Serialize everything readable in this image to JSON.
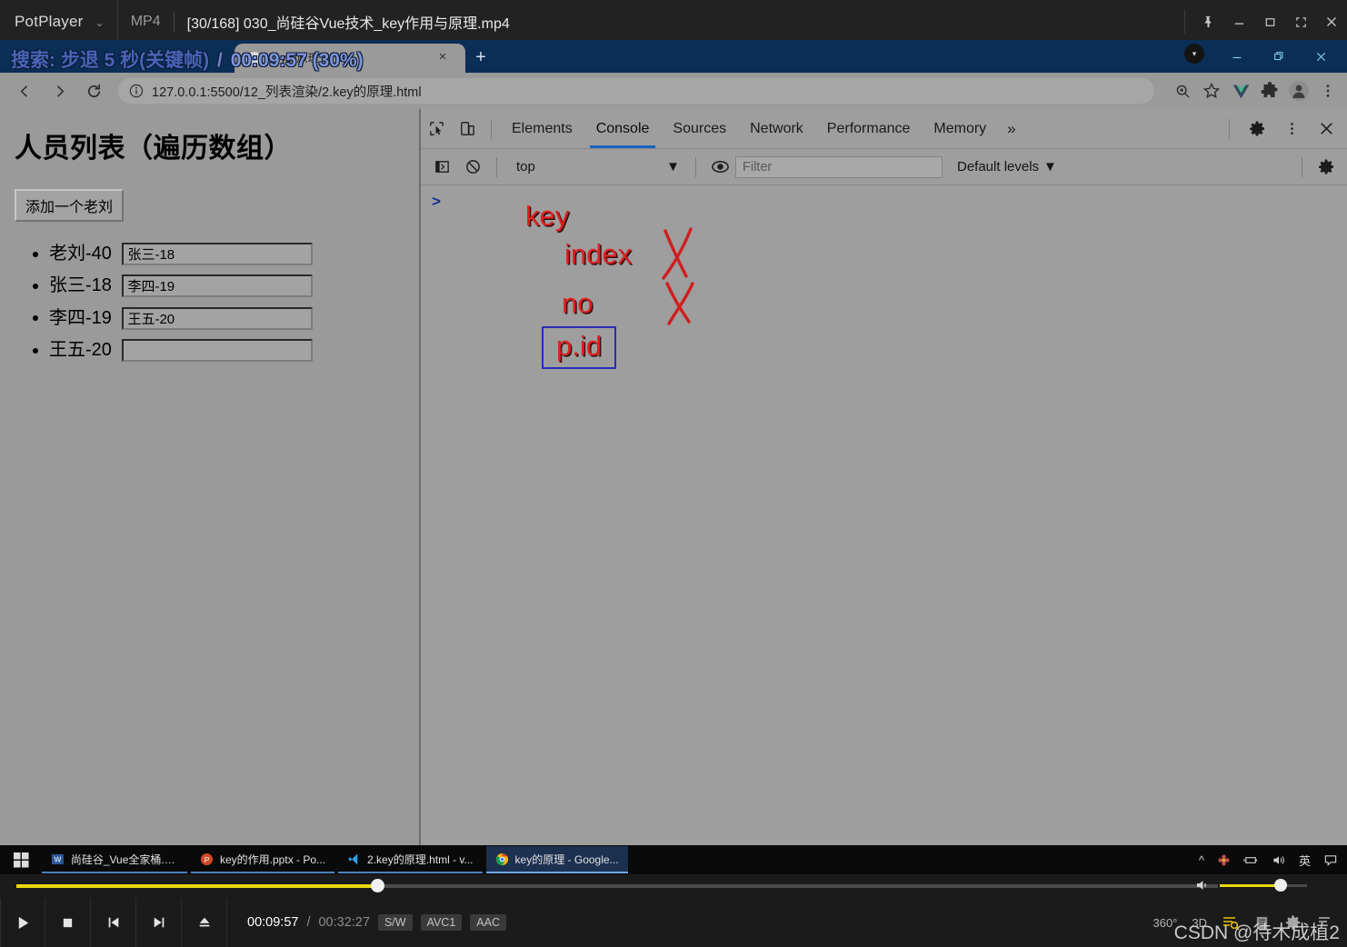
{
  "player": {
    "brand": "PotPlayer",
    "format": "MP4",
    "file_title": "[30/168] 030_尚硅谷Vue技术_key作用与原理.mp4",
    "osd_message": "搜索: 步退 5 秒(关键帧)",
    "osd_separator": "/",
    "osd_position": "00:09:57 (30%)",
    "current_time": "00:09:57",
    "total_time": "00:32:27",
    "time_separator": "/",
    "badges": [
      "S/W",
      "AVC1",
      "AAC"
    ],
    "progress_percent": 30,
    "volume_percent": 70,
    "right_labels": [
      "360°",
      "3D"
    ],
    "watermark": "CSDN @待木成植2",
    "window_buttons": [
      "pin",
      "minimize",
      "maximize",
      "fullscreen",
      "close"
    ]
  },
  "chrome": {
    "tab": {
      "title": "key的原理",
      "close_label": "×"
    },
    "new_tab_label": "+",
    "url": "127.0.0.1:5500/12_列表渲染/2.key的原理.html",
    "toolbar_icons": [
      "back-icon",
      "forward-icon",
      "reload-icon",
      "site-info-icon"
    ],
    "right_icons": [
      "zoom-icon",
      "bookmark-star-icon",
      "vue-devtools-icon",
      "extensions-icon",
      "profile-avatar-icon",
      "chrome-menu-icon"
    ],
    "window_buttons": [
      "minimize",
      "restore",
      "close"
    ],
    "osd_badge": "▾"
  },
  "page": {
    "heading": "人员列表（遍历数组）",
    "add_button": "添加一个老刘",
    "items": [
      {
        "label": "老刘-40",
        "input_value": "张三-18"
      },
      {
        "label": "张三-18",
        "input_value": "李四-19"
      },
      {
        "label": "李四-19",
        "input_value": "王五-20"
      },
      {
        "label": "王五-20",
        "input_value": ""
      }
    ],
    "input_placeholder": ""
  },
  "devtools": {
    "tabs": [
      {
        "label": "Elements",
        "active": false
      },
      {
        "label": "Console",
        "active": true
      },
      {
        "label": "Sources",
        "active": false
      },
      {
        "label": "Network",
        "active": false
      },
      {
        "label": "Performance",
        "active": false
      },
      {
        "label": "Memory",
        "active": false
      }
    ],
    "more_label": "»",
    "left_icons": [
      "inspect-element-icon",
      "device-toolbar-icon"
    ],
    "right_icons": [
      "settings-gear-icon",
      "devtools-menu-icon",
      "close-devtools-icon"
    ],
    "console": {
      "sidebar_toggle_icon": "console-sidebar-icon",
      "clear_icon": "clear-console-icon",
      "context": "top",
      "context_caret": "▼",
      "eye_icon": "live-expression-icon",
      "filter_placeholder": "Filter",
      "filter_value": "",
      "levels_label": "Default levels",
      "levels_caret": "▼",
      "settings_icon": "console-settings-icon",
      "prompt": ">"
    }
  },
  "annotations": [
    {
      "text": "key",
      "crossed": false,
      "boxed": false
    },
    {
      "text": "index",
      "crossed": true,
      "boxed": false
    },
    {
      "text": "no",
      "crossed": true,
      "boxed": false
    },
    {
      "text": "p.id",
      "crossed": false,
      "boxed": true
    }
  ],
  "taskbar": {
    "start_label": "start-icon",
    "items": [
      {
        "label": "尚硅谷_Vue全家桶.d...",
        "icon": "word-icon",
        "state": "open"
      },
      {
        "label": "key的作用.pptx - Po...",
        "icon": "powerpoint-icon",
        "state": "open"
      },
      {
        "label": "2.key的原理.html - v...",
        "icon": "vscode-icon",
        "state": "open"
      },
      {
        "label": "key的原理 - Google...",
        "icon": "chrome-icon",
        "state": "active"
      }
    ],
    "tray": {
      "chevron": "^",
      "ime": "英",
      "icons": [
        "chevron-up-icon",
        "flower-icon",
        "battery-icon",
        "volume-icon",
        "ime-label",
        "action-center-icon"
      ]
    }
  },
  "colors": {
    "accent_yellow": "#e8d80c",
    "annotation_red": "#e02020",
    "annotation_box_blue": "#2b2bbb",
    "devtools_active_tab": "#1664c0",
    "chrome_tabstrip": "#0b2e57",
    "page_bg": "#9a9a9a"
  }
}
